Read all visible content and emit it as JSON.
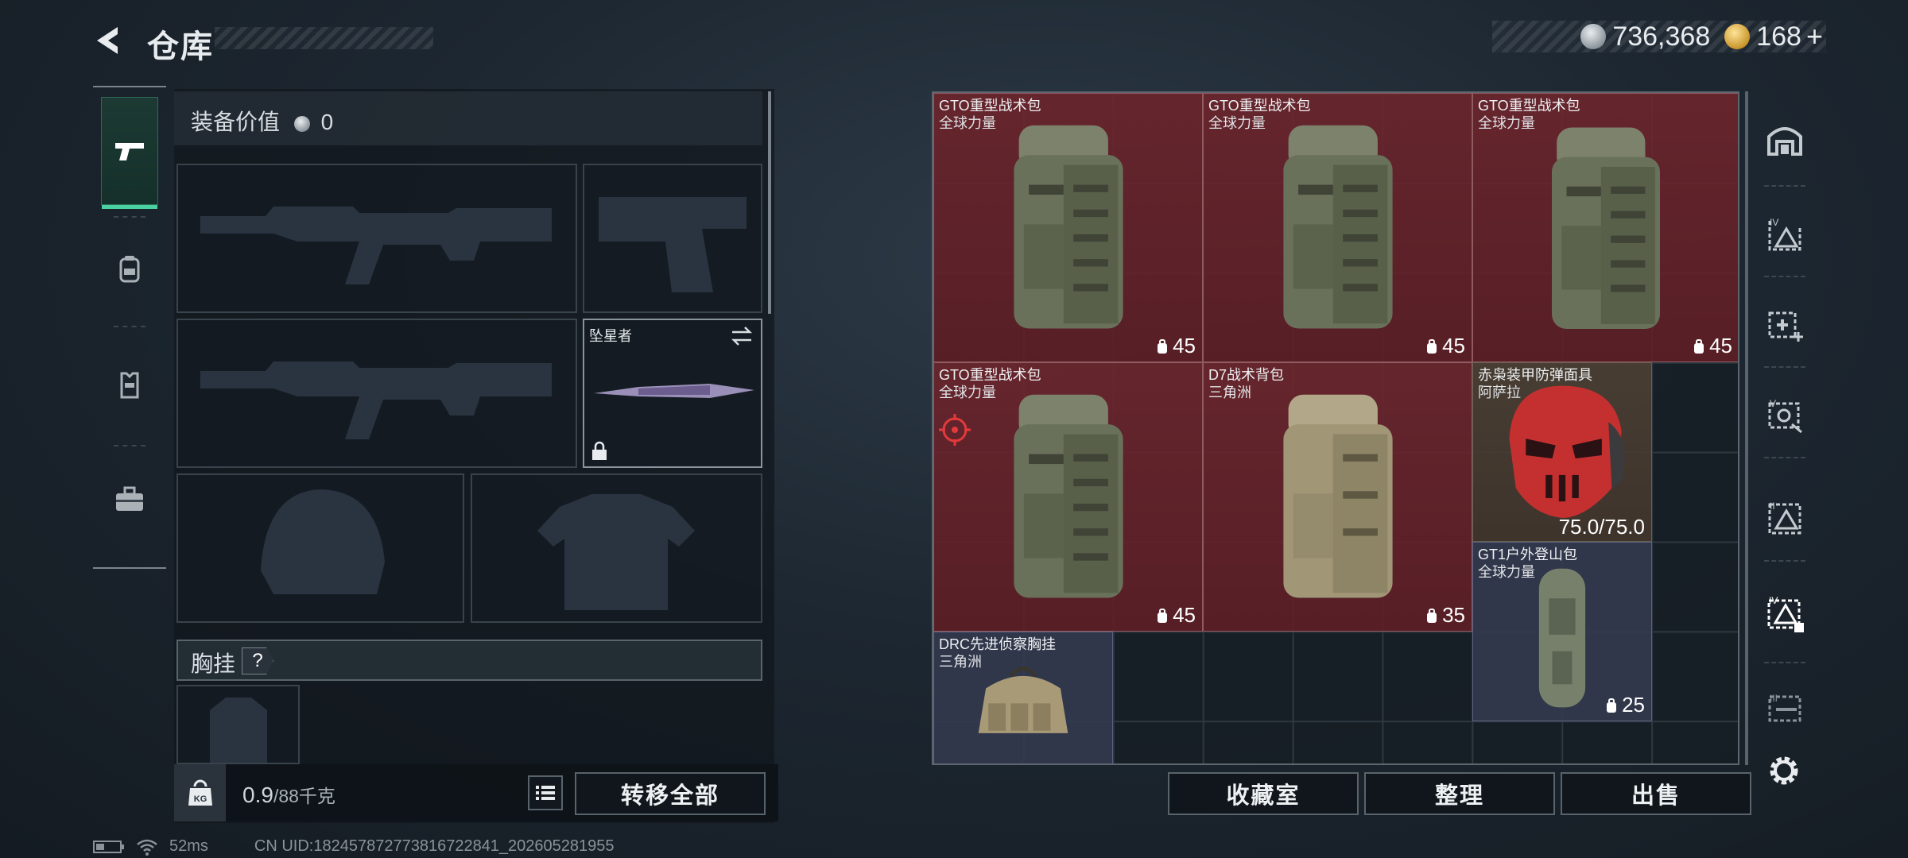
{
  "header": {
    "title": "仓库",
    "silver_amount": "736,368",
    "gold_amount": "168",
    "add_label": "+"
  },
  "sidebar": {
    "tabs": [
      {
        "name": "weapons",
        "active": true
      },
      {
        "name": "backpack",
        "active": false
      },
      {
        "name": "vest",
        "active": false
      },
      {
        "name": "case",
        "active": false
      }
    ]
  },
  "loadout": {
    "equip_value_label": "装备价值",
    "equip_value": "0",
    "melee_name": "坠星者",
    "chest_label": "胸挂",
    "chest_help": "?",
    "weight_current": "0.9",
    "weight_total": "/88千克",
    "transfer_all_label": "转移全部"
  },
  "stash": {
    "items": [
      {
        "name": "GTO重型战术包",
        "sub": "全球力量",
        "cap": "45",
        "style": "red",
        "art": "backpack-green"
      },
      {
        "name": "GTO重型战术包",
        "sub": "全球力量",
        "cap": "45",
        "style": "red",
        "art": "backpack-green"
      },
      {
        "name": "GTO重型战术包",
        "sub": "全球力量",
        "cap": "45",
        "style": "red",
        "art": "backpack-green"
      },
      {
        "name": "GTO重型战术包",
        "sub": "全球力量",
        "cap": "45",
        "style": "red",
        "art": "backpack-green",
        "marked": true
      },
      {
        "name": "D7战术背包",
        "sub": "三角洲",
        "cap": "35",
        "style": "red",
        "art": "backpack-tan"
      },
      {
        "name": "赤枭装甲防弹面具",
        "sub": "阿萨拉",
        "durability": "75.0/75.0",
        "style": "brown",
        "art": "red-mask"
      },
      {
        "name": "GT1户外登山包",
        "sub": "全球力量",
        "cap": "25",
        "style": "blue",
        "art": "backpack-slim"
      },
      {
        "name": "DRC先进侦察胸挂",
        "sub": "三角洲",
        "style": "blue",
        "art": "chest-rig"
      }
    ],
    "buttons": {
      "collection": "收藏室",
      "organize": "整理",
      "sell": "出售"
    }
  },
  "status": {
    "ping": "52ms",
    "uid": "CN UID:1824578727738167228​41_202605281955"
  },
  "colors": {
    "accent": "#49d1a2",
    "item_red": "#6e2630",
    "crosshair": "#e23a3a"
  }
}
